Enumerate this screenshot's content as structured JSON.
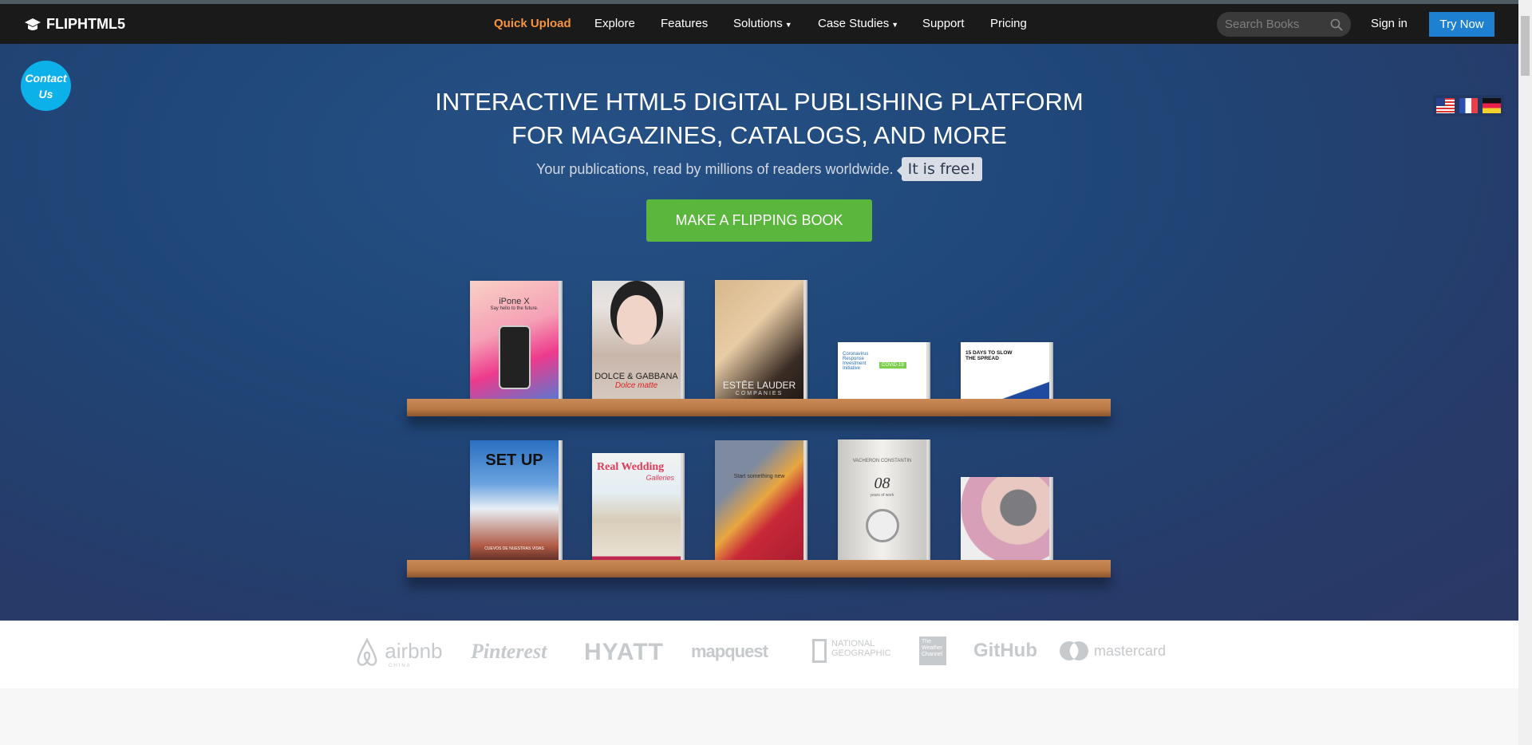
{
  "nav": {
    "logo": "FLIPHTML5",
    "items": [
      {
        "label": "Quick Upload",
        "active": true
      },
      {
        "label": "Explore"
      },
      {
        "label": "Features"
      },
      {
        "label": "Solutions",
        "dropdown": true
      },
      {
        "label": "Case Studies",
        "dropdown": true
      },
      {
        "label": "Support"
      },
      {
        "label": "Pricing"
      }
    ],
    "search_placeholder": "Search Books",
    "signin": "Sign in",
    "try_now": "Try Now"
  },
  "contact": {
    "line1": "Contact",
    "line2": "Us"
  },
  "flags": [
    "us-flag",
    "france-flag",
    "germany-flag"
  ],
  "hero": {
    "title_line1": "INTERACTIVE HTML5 DIGITAL PUBLISHING PLATFORM",
    "title_line2": "FOR MAGAZINES, CATALOGS, AND MORE",
    "subtitle": "Your publications, read by millions of readers worldwide.",
    "free_tag": "It is free!",
    "cta": "MAKE A FLIPPING BOOK"
  },
  "books": {
    "row1": [
      {
        "title": "iPone X",
        "sub": "Say hello to the future."
      },
      {
        "title": "DOLCE & GABBANA",
        "sub": "Dolce matte"
      },
      {
        "title": "ESTĒE LAUDER",
        "sub": "COMPANIES"
      },
      {
        "title": "Coronavirus Response Investment Initiative",
        "sub": "COVID-19"
      },
      {
        "title": "15 DAYS TO SLOW THE SPREAD",
        "sub": ""
      }
    ],
    "row2": [
      {
        "title": "SET UP",
        "sub": "CUEVOS DE NUESTRAS VIDAS"
      },
      {
        "title": "Real Wedding",
        "sub": "Galleries"
      },
      {
        "title": "Start something new",
        "sub": ""
      },
      {
        "title": "VACHERON CONSTANTIN",
        "sub": "08",
        "sub2": "years of work"
      },
      {
        "title": "",
        "sub": ""
      }
    ]
  },
  "logos": {
    "airbnb": "airbnb",
    "airbnb_sub": "CHINA",
    "pinterest": "Pinterest",
    "hyatt": "HYATT",
    "mapquest": "mapquest",
    "natgeo1": "NATIONAL",
    "natgeo2": "GEOGRAPHIC",
    "weather": "The Weather Channel",
    "github": "GitHub",
    "mastercard": "mastercard"
  },
  "colors": {
    "nav_bg": "#1a1a1a",
    "active": "#f7943c",
    "try_now": "#1e80d0",
    "cta": "#5bb63e",
    "contact": "#0db1ea"
  }
}
